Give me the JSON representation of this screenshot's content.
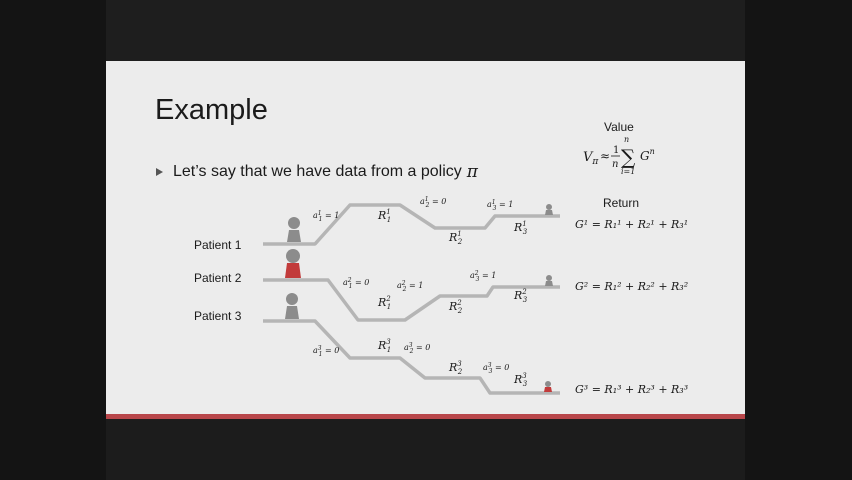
{
  "slide": {
    "title": "Example",
    "bullet": "Let’s say that we have data from a policy",
    "bullet_symbol": "π",
    "value_header": "Value",
    "return_header": "Return"
  },
  "patients": [
    {
      "label": "Patient 1",
      "return_eq": "G¹ = R₁¹ + R₂¹ + R₃¹"
    },
    {
      "label": "Patient 2",
      "return_eq": "G² = R₁² + R₂² + R₃²"
    },
    {
      "label": "Patient 3",
      "return_eq": "G³ = R₁³ + R₂³ + R₃³"
    }
  ],
  "colors": {
    "slide_bg": "#ececec",
    "accent_bar": "#b8464a",
    "path": "#b5b5b5",
    "figure_gray": "#8c8c8c",
    "figure_red": "#c23b3b"
  }
}
